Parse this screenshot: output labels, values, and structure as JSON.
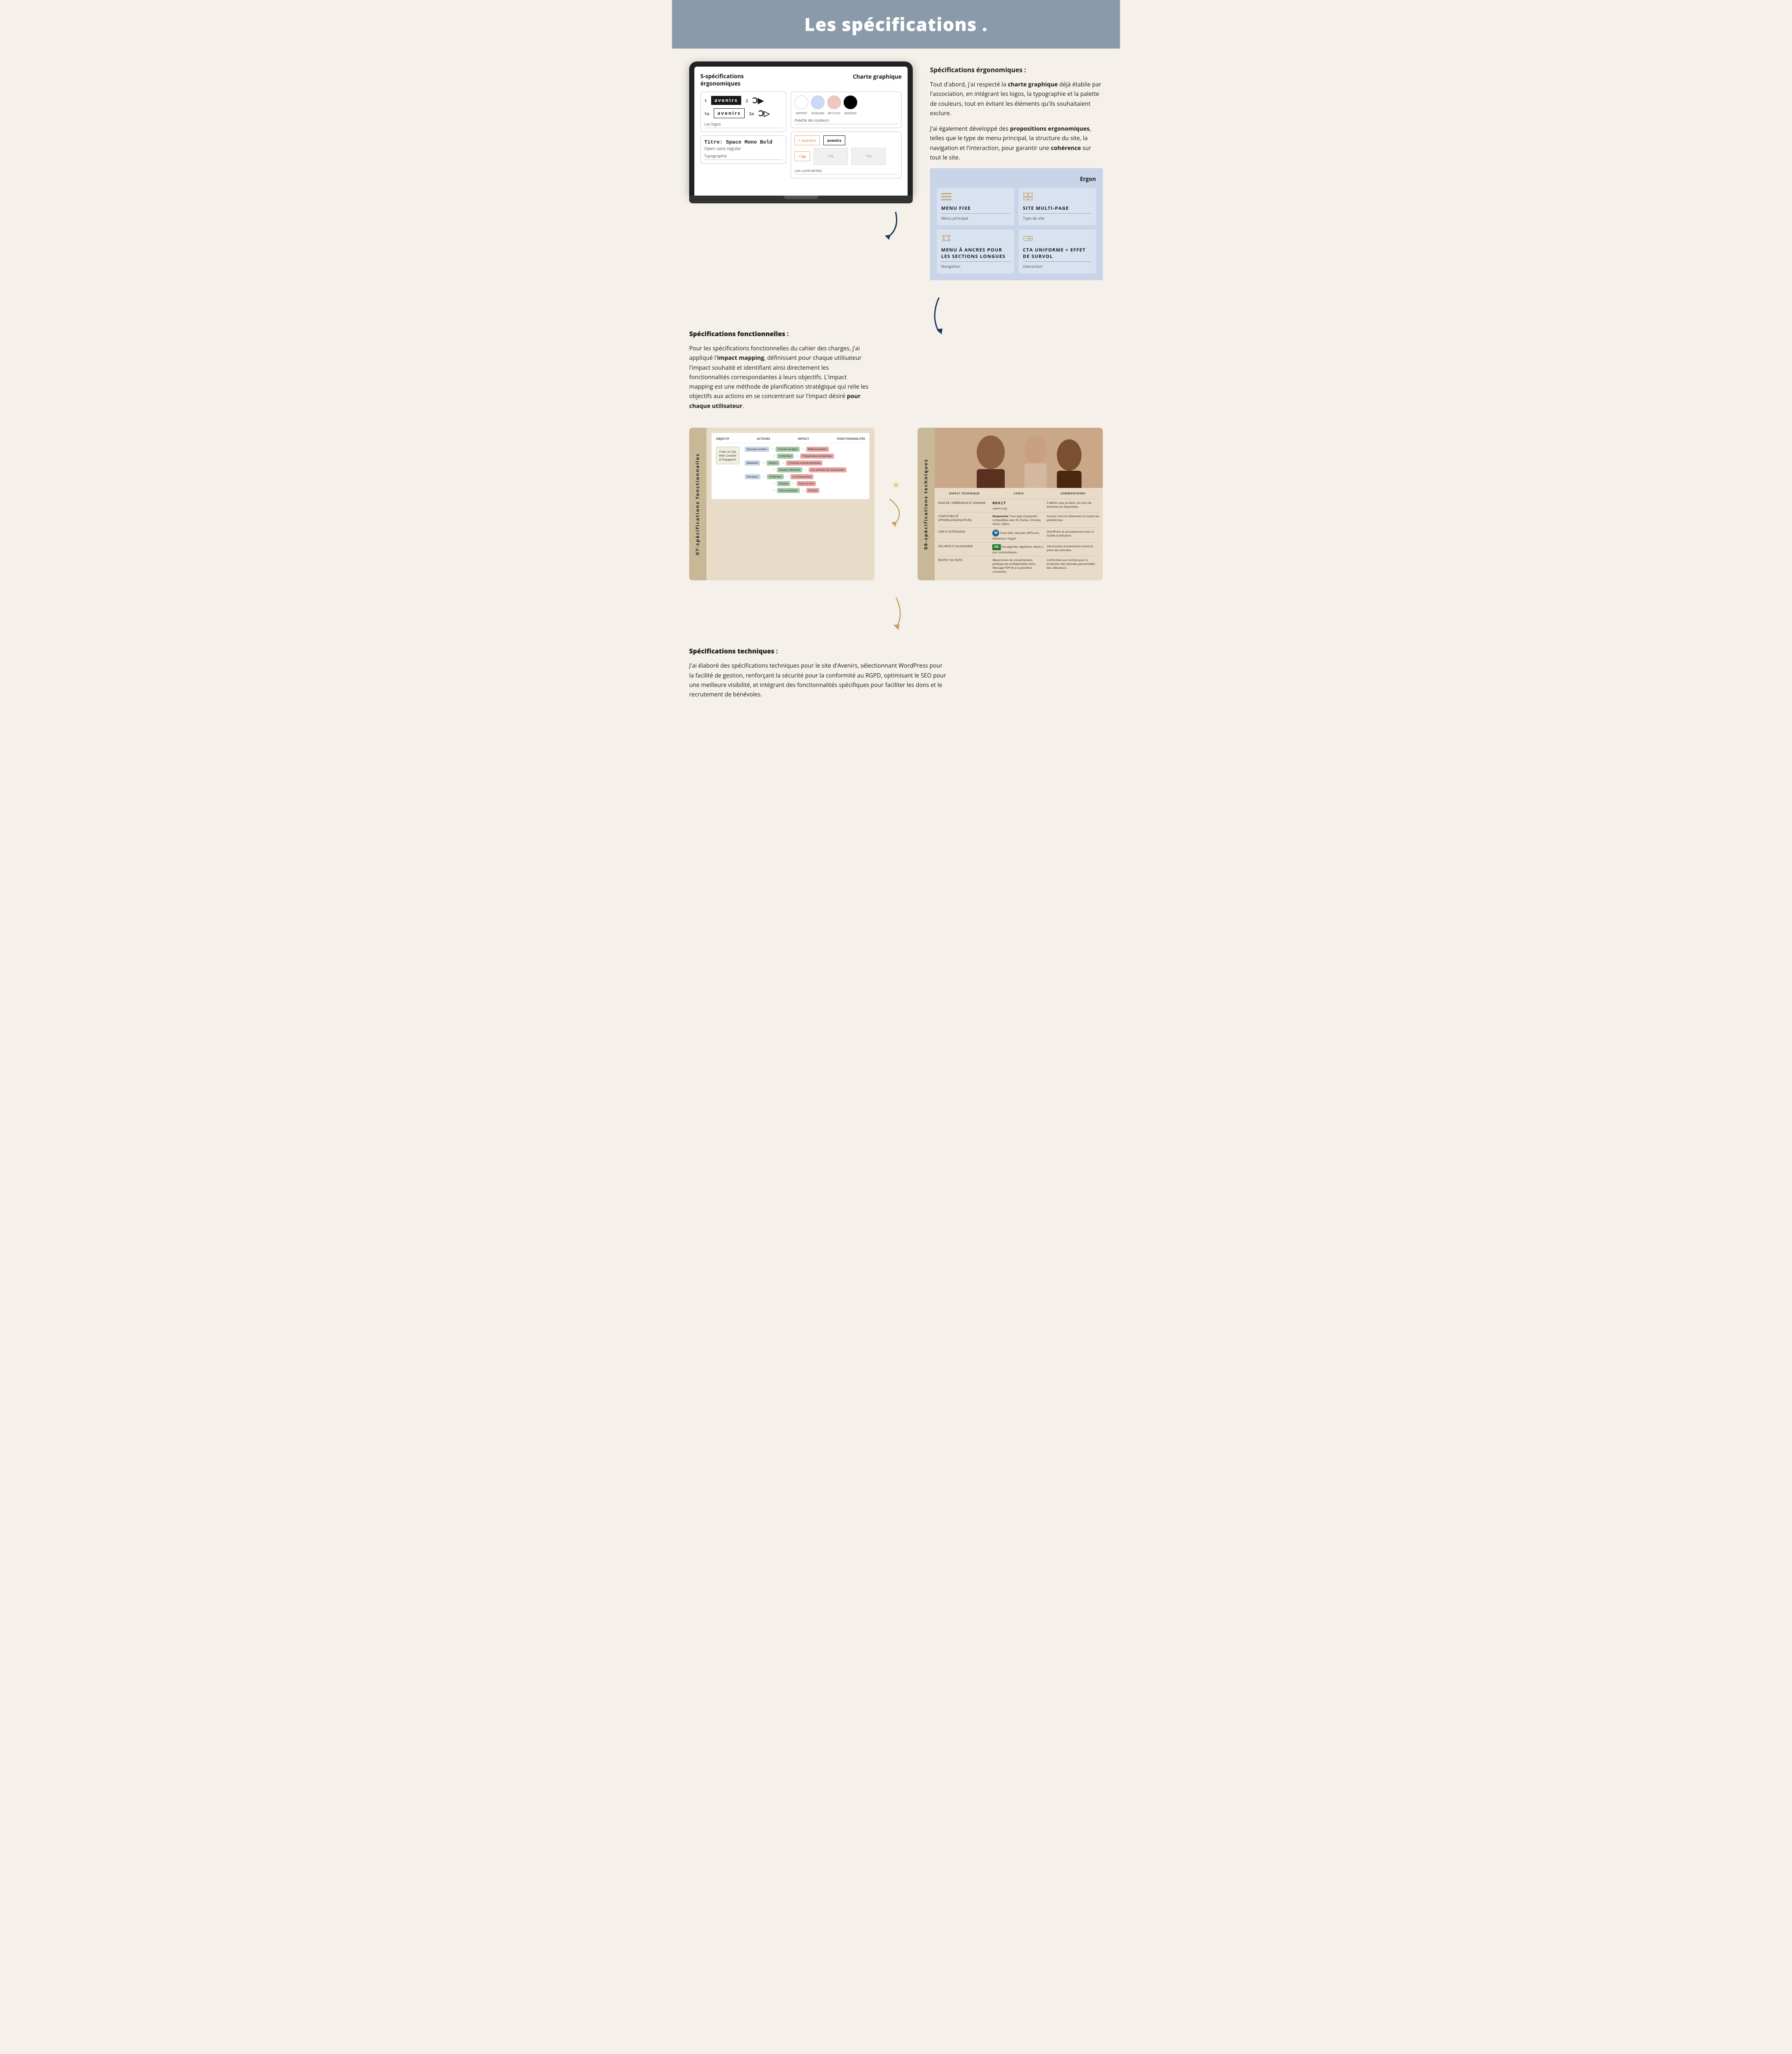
{
  "page": {
    "title": "Les spécifications ."
  },
  "header": {
    "title": "Les spécifications ."
  },
  "ergo_section": {
    "heading": "Spécifications érgonomiques :",
    "paragraph1_before": "Tout d'abord, j'ai respecté la ",
    "paragraph1_bold": "charte graphique",
    "paragraph1_after": " déjà établie par l'association, en intégrant les logos, la typographie et la palette de couleurs, tout en évitant les éléments qu'ils souhaitaient exclure.",
    "paragraph2_before": "J'ai également développé des ",
    "paragraph2_bold": "propositions ergonomiques",
    "paragraph2_after": ", telles que le type de menu principal, la structure du site, la navigation et l'interaction, pour garantir une ",
    "paragraph2_bold2": "cohérence",
    "paragraph2_end": " sur tout le site."
  },
  "laptop": {
    "title_left": "5-spécifications\nérgonomiques",
    "title_right": "Charte graphique",
    "logos_label": "Les logos",
    "typo_label": "Typographie",
    "typo_title": "Titre: Space Mono Bold",
    "typo_sub": "Open sans regular",
    "colors_label": "Palette de couleurs",
    "color_values": [
      "#FFFFFF",
      "#C8DAF8",
      "#F1C5C0",
      "#000000"
    ],
    "contraintes_label": "Les contraintes"
  },
  "ergo_card": {
    "title": "Ergon",
    "items": [
      {
        "icon": "≡",
        "title": "MENU FIXE",
        "label": "Menu principal"
      },
      {
        "icon": "⊞",
        "title": "SITE MULTI-PAGE",
        "label": "Type de site"
      },
      {
        "icon": "⋈",
        "title": "MENU À ANCRES POUR LES SECTIONS LONGUES",
        "label": "Navigation"
      },
      {
        "icon": "→",
        "title": "CTA UNIFORME + EFFET DE SURVOL",
        "label": "Interaction"
      }
    ]
  },
  "functional_section": {
    "heading": "Spécifications fonctionnelles :",
    "paragraph": "Pour les spécifications fonctionnelles du cahier des charges, j'ai appliqué l'impact mapping, définissant pour chaque utilisateur l'impact souhaité et identifiant ainsi directement les fonctionnalités correspondantes à leurs objectifs. L'impact mapping est une méthode de planification stratégique qui relie les objectifs aux actions en se concentrant sur l'impact désiré pour chaque utilisateur.",
    "bold_phrase": "impact mapping",
    "bold_end": "pour chaque utilisateur"
  },
  "functional_card": {
    "label": "07-spécifications\nfonctionnelles",
    "diagram": {
      "headers": [
        "OBJECTIF",
        "ACTEURS",
        "IMPACT",
        "FONCTIONNALITÉS"
      ],
      "objectif": "Créer un Site\nWeb Complet\net Engageant",
      "actors": [
        "Nouveau visiteur",
        "Bénévole",
        "Donateur"
      ],
      "impacts": [
        "Trouver en ligne",
        "S'informer",
        "Devenir bénévole",
        "Devenir donateur",
        "S'informer",
        "Donner"
      ],
      "actions": [
        "Actions",
        "Présentation et données",
        "S'inscrire comme bénévole",
        "S'inscrire comme donateur",
        "Les activités de l'association",
        "La Financement",
        "Faire un don",
        "Nous contacter",
        "Contact",
        "Conformément légale",
        "S'inscrire Ici"
      ]
    }
  },
  "technical_card": {
    "label": "08-spécifications\ntechniques",
    "headers": [
      "ASPECT TECHNIQUE",
      "CHOIX",
      "COMMENTAIRES"
    ],
    "rows": [
      {
        "aspect": "NOM DE L'HÉBERGEUR ET DOMAINE",
        "choix": "NUXiT\navenirs.org",
        "comment": "À définir avec le client. (Ce nom de domaine est disponible)"
      },
      {
        "aspect": "COMPATIBILITÉ APPAREILS/NAVIGATEURS",
        "choix": "Responsive: Tous type d'appareils compatibles avec IE, Firefox, Chrome, Safari, Opéra",
        "comment": "Assurer une UX cohérente sur toutes les plateformes."
      },
      {
        "aspect": "CMR ET EXTENSIONS",
        "choix": "Yoast SEO, Akismet, WPForms, Elementor, Paypal",
        "comment": "WordPress et ses extensions pour la facilité d'utilisation."
      },
      {
        "aspect": "SÉCURITÉ ET SAUVEGARDE",
        "choix": "Sauvegardes régulières. Mises à jour automatiques.",
        "comment": "Sécurisation et prévention contre la perte des données."
      },
      {
        "aspect": "RESPECT DU RGPD",
        "choix": "Mécanismes de consentement, politique de confidentialité claire. Message POP-IN à la première connexion.",
        "comment": "Conformité aux normes pour la protection des données personnelles des utilisateurs."
      }
    ]
  },
  "tech_section": {
    "heading": "Spécifications techniques :",
    "paragraph": "J'ai élaboré des spécifications techniques pour le site d'Avenirs, sélectionnant WordPress pour la facilité de gestion, renforçant la sécurité pour la conformité au RGPD, optimisant le SEO pour une meilleure visibilité, et intégrant des fonctionnalités spécifiques pour faciliter les dons et le recrutement de bénévoles."
  }
}
